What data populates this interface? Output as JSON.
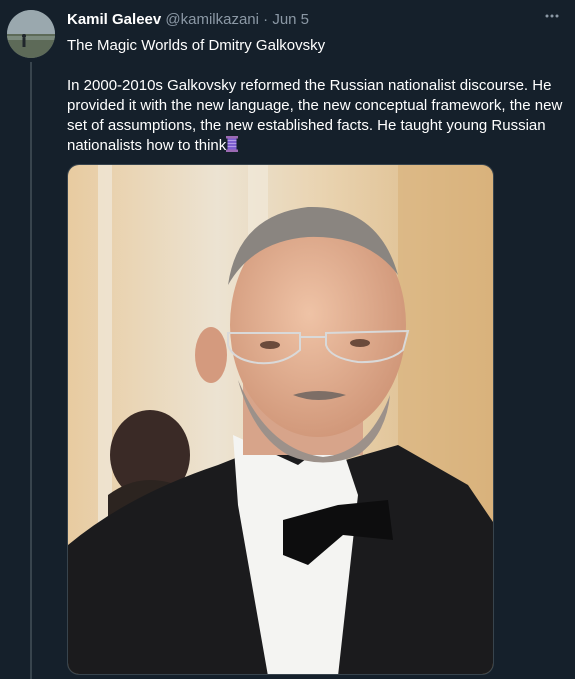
{
  "tweet": {
    "author": {
      "display_name": "Kamil Galeev",
      "handle": "@kamilkazani",
      "date": "Jun 5"
    },
    "more_icon": "more-horizontal-icon",
    "title_line": "The Magic Worlds of Dmitry Galkovsky",
    "body": "In 2000-2010s Galkovsky reformed the Russian nationalist discourse. He provided it with the new language, the new conceptual framework, the new set of assumptions, the new established facts. He taught young Russian nationalists how to think",
    "body_emoji": "thread-spool-icon",
    "media": {
      "kind": "photo"
    }
  },
  "colors": {
    "background": "#15202b",
    "text": "#ffffff",
    "muted": "#8b98a5",
    "divider": "#38444d"
  }
}
